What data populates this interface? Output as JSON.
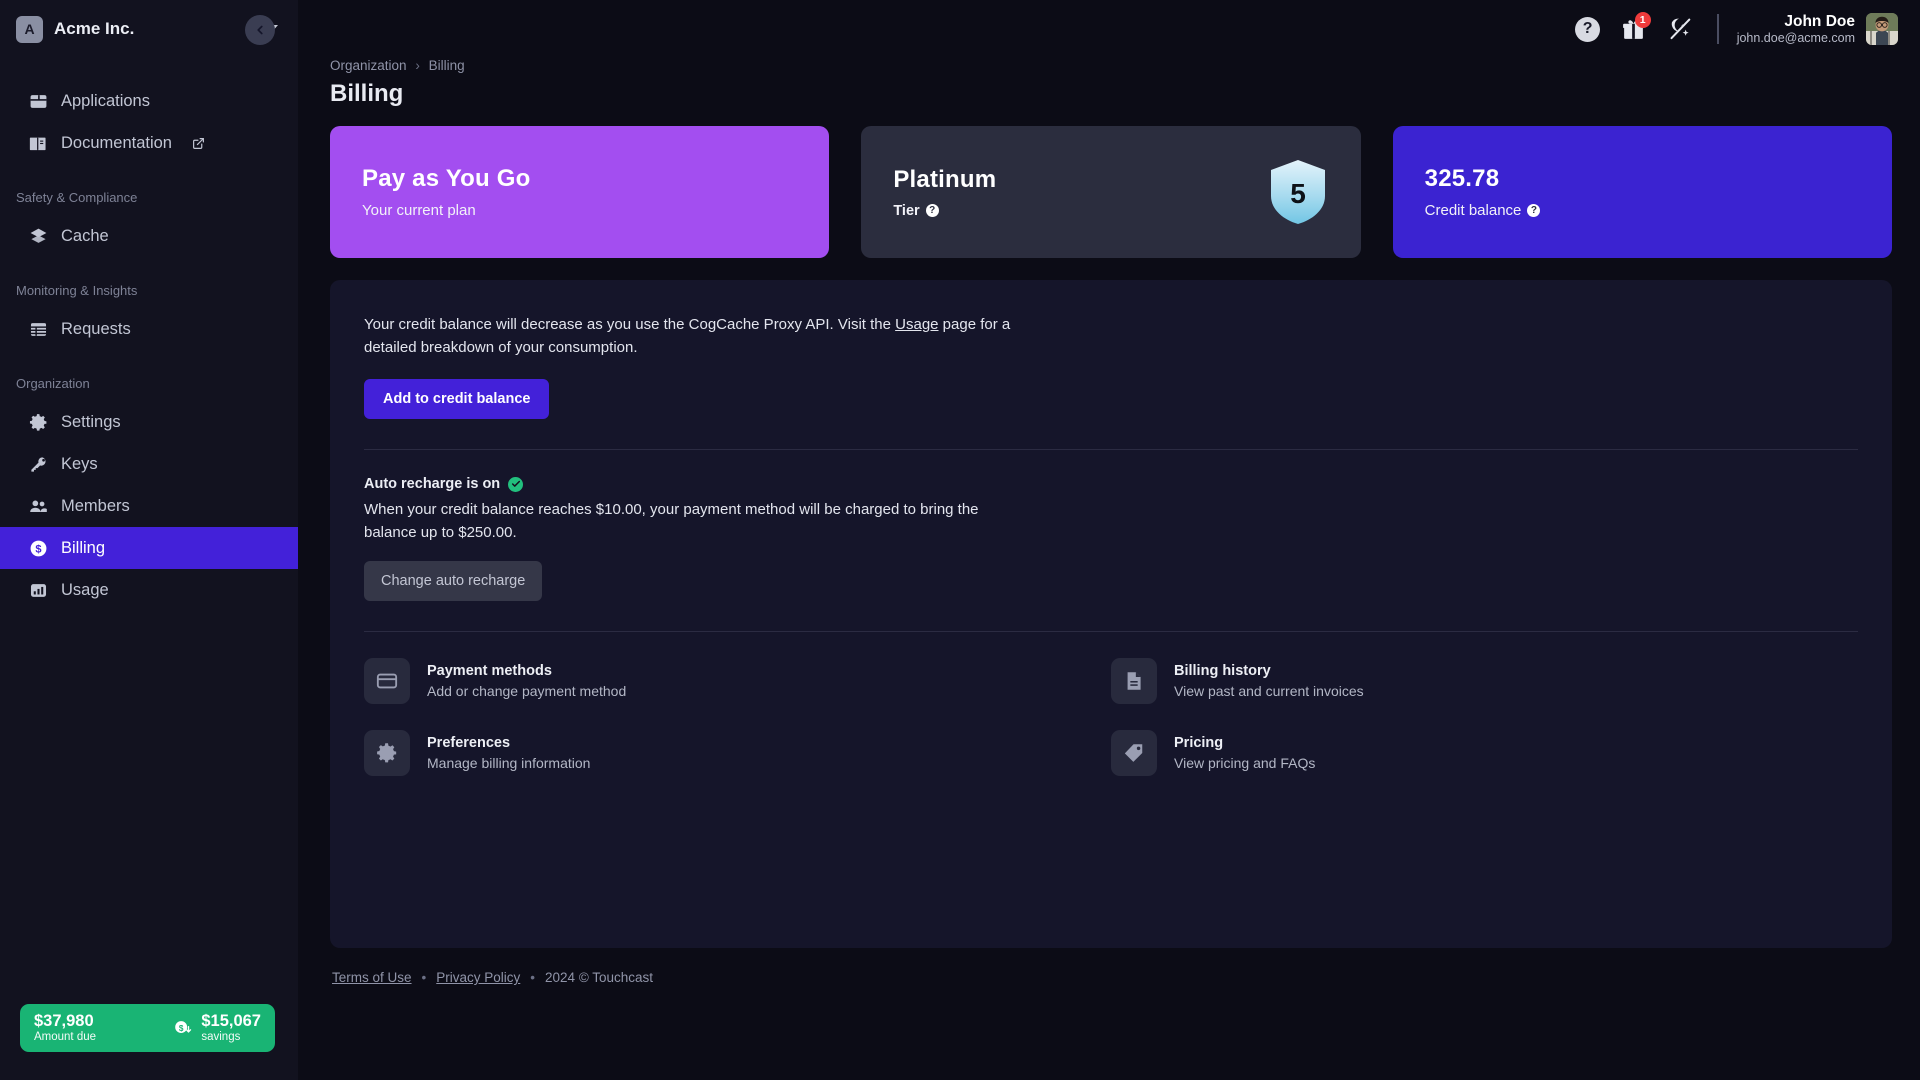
{
  "sidebar": {
    "org": {
      "initial": "A",
      "name": "Acme Inc."
    },
    "collapse_label": "Collapse sidebar",
    "items": [
      {
        "label": "Applications",
        "icon": "applications-icon",
        "external": false,
        "active": false
      },
      {
        "label": "Documentation",
        "icon": "documentation-icon",
        "external": true,
        "active": false
      }
    ],
    "sections": [
      {
        "label": "Safety & Compliance",
        "items": [
          {
            "label": "Cache",
            "icon": "layers-icon",
            "active": false
          }
        ]
      },
      {
        "label": "Monitoring & Insights",
        "items": [
          {
            "label": "Requests",
            "icon": "table-icon",
            "active": false
          }
        ]
      },
      {
        "label": "Organization",
        "items": [
          {
            "label": "Settings",
            "icon": "gear-icon",
            "active": false
          },
          {
            "label": "Keys",
            "icon": "key-icon",
            "active": false
          },
          {
            "label": "Members",
            "icon": "members-icon",
            "active": false
          },
          {
            "label": "Billing",
            "icon": "dollar-circle-icon",
            "active": true
          },
          {
            "label": "Usage",
            "icon": "bar-chart-icon",
            "active": false
          }
        ]
      }
    ],
    "savings_card": {
      "amount": "$37,980",
      "amount_label": "Amount due",
      "savings_amount": "$15,067",
      "savings_label": "savings",
      "color": "#19b474"
    }
  },
  "topbar": {
    "help_glyph": "?",
    "gift_badge": "1",
    "theme_toggle_name": "theme-toggle",
    "user": {
      "name": "John Doe",
      "email": "john.doe@acme.com"
    }
  },
  "breadcrumb": {
    "root": "Organization",
    "separator": "›",
    "current": "Billing"
  },
  "page_title": "Billing",
  "cards": [
    {
      "value": "Pay as You Go",
      "label": "Your current plan",
      "color": "#a34ef0",
      "has_info": false,
      "badge": null
    },
    {
      "value": "Platinum",
      "label": "Tier",
      "color": "#2b2d3e",
      "has_info": true,
      "badge": "5"
    },
    {
      "value": "325.78",
      "label": "Credit balance",
      "color": "#3b23d1",
      "has_info": true,
      "badge": null
    }
  ],
  "panel": {
    "intro_before": "Your credit balance will decrease as you use the CogCache Proxy API. Visit the ",
    "intro_link": "Usage",
    "intro_after": " page for a detailed breakdown of your consumption.",
    "add_credit_button": "Add to credit balance",
    "auto_recharge_title": "Auto recharge is on",
    "auto_recharge_text": "When your credit balance reaches $10.00, your payment method will be charged to bring the balance up to $250.00.",
    "change_recharge_button": "Change auto recharge",
    "tiles": [
      {
        "title": "Payment methods",
        "sub": "Add or change payment method",
        "icon": "credit-card-icon"
      },
      {
        "title": "Billing history",
        "sub": "View past and current invoices",
        "icon": "document-icon"
      },
      {
        "title": "Preferences",
        "sub": "Manage billing information",
        "icon": "gear-icon"
      },
      {
        "title": "Pricing",
        "sub": "View pricing and FAQs",
        "icon": "tag-icon"
      }
    ]
  },
  "footer": {
    "terms": "Terms of Use",
    "privacy": "Privacy Policy",
    "copyright": "2024 © Touchcast",
    "dot": "•"
  }
}
